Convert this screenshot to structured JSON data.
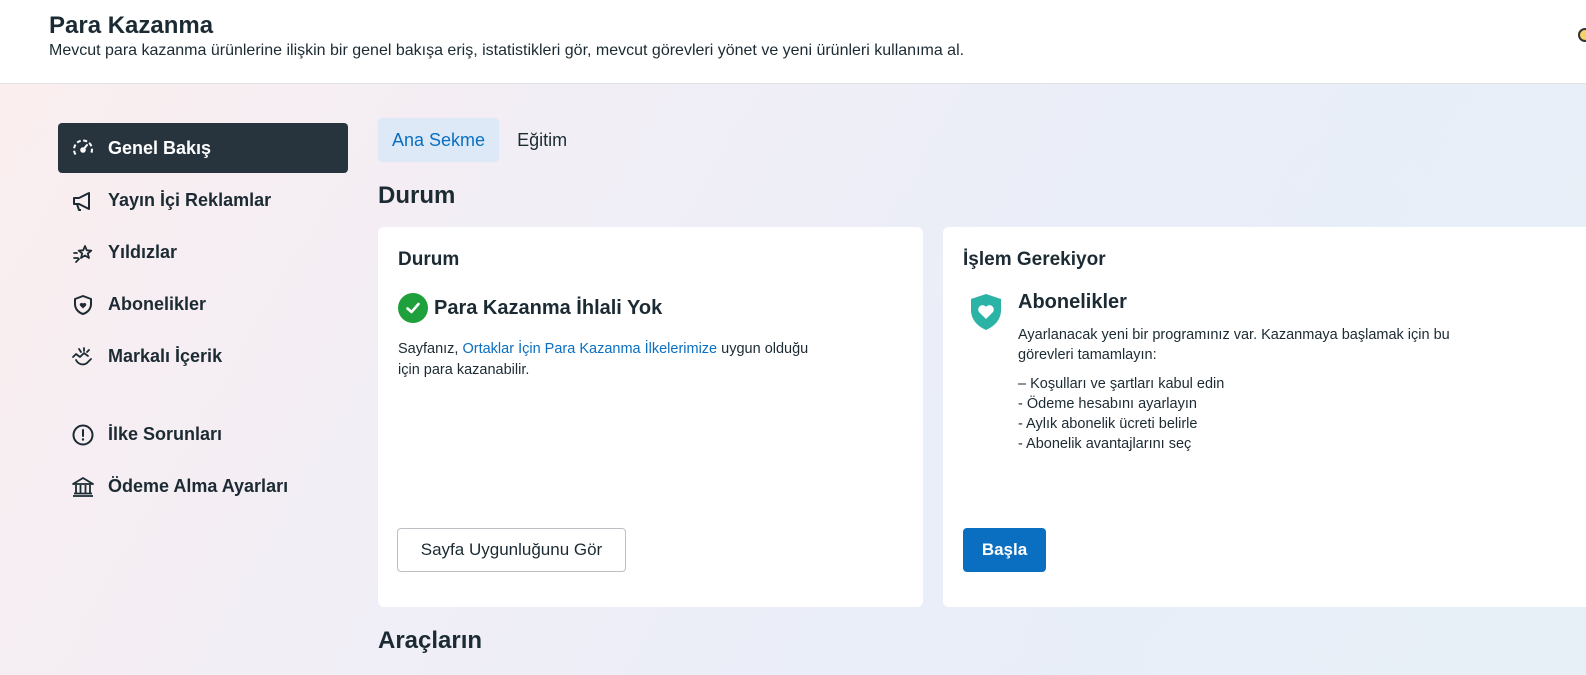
{
  "header": {
    "title": "Para Kazanma",
    "subtitle": "Mevcut para kazanma ürünlerine ilişkin bir genel bakışa eriş, istatistikleri gör, mevcut görevleri yönet ve yeni ürünleri kullanıma al."
  },
  "sidebar": {
    "items": [
      {
        "label": "Genel Bakış",
        "icon": "gauge-icon"
      },
      {
        "label": "Yayın İçi Reklamlar",
        "icon": "megaphone-icon"
      },
      {
        "label": "Yıldızlar",
        "icon": "star-burst-icon"
      },
      {
        "label": "Abonelikler",
        "icon": "shield-icon"
      },
      {
        "label": "Markalı İçerik",
        "icon": "handshake-icon"
      },
      {
        "label": "İlke Sorunları",
        "icon": "alert-circle-icon"
      },
      {
        "label": "Ödeme Alma Ayarları",
        "icon": "bank-icon"
      }
    ]
  },
  "tabs": [
    {
      "label": "Ana Sekme"
    },
    {
      "label": "Eğitim"
    }
  ],
  "sections": {
    "status_title": "Durum",
    "tools_title": "Araçların"
  },
  "status_card": {
    "heading": "Durum",
    "status_text": "Para Kazanma İhlali Yok",
    "desc_before": "Sayfanız, ",
    "desc_link": "Ortaklar İçin Para Kazanma İlkelerimize",
    "desc_after_line1": " uygun olduğu",
    "desc_line2": "için para kazanabilir.",
    "button_label": "Sayfa Uygunluğunu Gör"
  },
  "action_card": {
    "heading": "İşlem Gerekiyor",
    "title": "Abonelikler",
    "desc_line1": "Ayarlanacak yeni bir programınız var. Kazanmaya başlamak için bu",
    "desc_line2": "görevleri tamamlayın:",
    "tasks": [
      "– Koşulları ve şartları kabul edin",
      "- Ödeme hesabını ayarlayın",
      "- Aylık abonelik ücreti belirle",
      "- Abonelik avantajlarını seç"
    ],
    "button_label": "Başla"
  },
  "colors": {
    "accent": "#0a6fc1",
    "active_nav": "#27343e",
    "success": "#1ea03c",
    "subscriptions_icon": "#2bb3a6"
  }
}
